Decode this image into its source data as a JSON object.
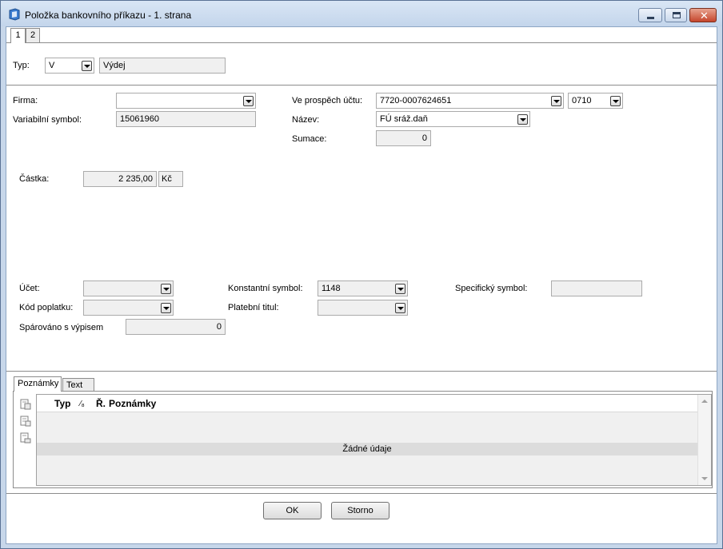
{
  "window": {
    "title": "Položka bankovního příkazu - 1. strana",
    "close_glyph": "✕"
  },
  "page_tabs": [
    "1",
    "2"
  ],
  "header": {
    "typ_label": "Typ:",
    "typ_value": "V",
    "typ_desc": "Výdej"
  },
  "main": {
    "firma_label": "Firma:",
    "firma_value": "",
    "varsym_label": "Variabilní symbol:",
    "varsym_value": "15061960",
    "ucet_prospech_label": "Ve prospěch účtu:",
    "ucet_prospech_value": "7720-0007624651",
    "bank_code_value": "0710",
    "nazev_label": "Název:",
    "nazev_value": "FÚ sráž.daň",
    "sumace_label": "Sumace:",
    "sumace_value": "0",
    "castka_label": "Částka:",
    "castka_value": "2 235,00",
    "mena_value": "Kč"
  },
  "details": {
    "ucet_label": "Účet:",
    "ucet_value": "",
    "kod_poplatku_label": "Kód poplatku:",
    "kod_poplatku_value": "",
    "sparovano_label": "Spárováno s výpisem",
    "sparovano_value": "0",
    "konst_label": "Konstantní symbol:",
    "konst_value": "1148",
    "platebni_label": "Platební titul:",
    "platebni_value": "",
    "spec_label": "Specifický symbol:",
    "spec_value": ""
  },
  "notes": {
    "tabs": [
      "Poznámky",
      "Text"
    ],
    "columns": [
      "Typ",
      "⁄₈",
      "Ř.",
      "Poznámky"
    ],
    "empty_text": "Žádné údaje"
  },
  "buttons": {
    "ok": "OK",
    "cancel": "Storno"
  },
  "colors": {
    "window_frame": "#c7d7ea",
    "close_button": "#c5462c",
    "readonly_bg": "#f0f0f0"
  }
}
